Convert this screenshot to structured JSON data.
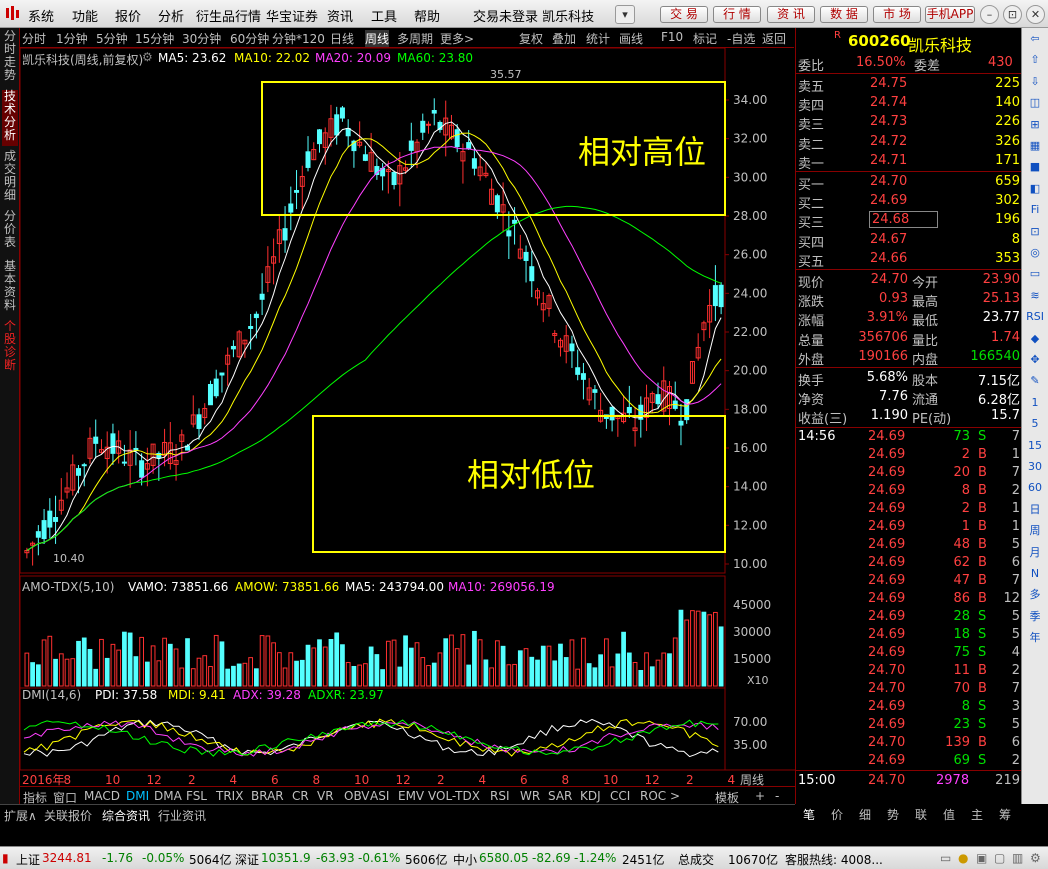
{
  "menubar": {
    "items": [
      "系统",
      "功能",
      "报价",
      "分析",
      "衍生品行情",
      "华宝证券",
      "资讯",
      "工具",
      "帮助"
    ],
    "title": "交易未登录  凯乐科技",
    "buttons": [
      "交 易",
      "行 情",
      "资 讯",
      "数 据",
      "市 场",
      "手机APP"
    ]
  },
  "toolbar": {
    "items": [
      "分时",
      "1分钟",
      "5分钟",
      "15分钟",
      "30分钟",
      "60分钟",
      "分钟*120",
      "日线",
      "周线",
      "多周期",
      "更多>"
    ],
    "active": "周线",
    "right": [
      "复权",
      "叠加",
      "统计",
      "画线",
      "F10",
      "标记",
      "-自选",
      "返回"
    ]
  },
  "left_tabs": [
    "分时走势",
    "技术分析",
    "成交明细",
    "分价表",
    "基本资料",
    "个股诊断"
  ],
  "chart_header": {
    "name": "凯乐科技(周线,前复权)",
    "ma5": "MA5: 23.62",
    "ma10": "MA10: 22.02",
    "ma20": "MA20: 20.09",
    "ma60": "MA60: 23.80"
  },
  "price_axis": [
    "34.00",
    "32.00",
    "30.00",
    "28.00",
    "26.00",
    "24.00",
    "22.00",
    "20.00",
    "18.00",
    "16.00",
    "14.00",
    "12.00",
    "10.00"
  ],
  "annotations": {
    "high_label": "相对高位",
    "low_label": "相对低位",
    "max_price": "35.57",
    "min_price": "10.40"
  },
  "volume_header": {
    "name": "AMO-TDX(5,10)",
    "vamo": "VAMO: 73851.66",
    "amow": "AMOW: 73851.66",
    "ma5": "MA5: 243794.00",
    "ma10": "MA10: 269056.19"
  },
  "volume_axis": [
    "45000",
    "30000",
    "15000"
  ],
  "volume_unit": "X10",
  "dmi_header": {
    "name": "DMI(14,6)",
    "pdi": "PDI: 37.58",
    "mdi": "MDI: 9.41",
    "adx": "ADX: 39.28",
    "adxr": "ADXR: 23.97"
  },
  "dmi_axis": [
    "70.00",
    "35.00"
  ],
  "date_axis": [
    "2016年",
    "8",
    "10",
    "12",
    "2",
    "4",
    "6",
    "8",
    "10",
    "12",
    "2",
    "4",
    "6",
    "8",
    "10",
    "12",
    "2",
    "4"
  ],
  "date_axis_right": "周线",
  "indicator_tabs": [
    "指标",
    "窗口",
    "MACD",
    "DMI",
    "DMA",
    "FSL",
    "TRIX",
    "BRAR",
    "CR",
    "VR",
    "OBV",
    "ASI",
    "EMV",
    "VOL-TDX",
    "RSI",
    "WR",
    "SAR",
    "KDJ",
    "CCI",
    "ROC",
    ">",
    "模板",
    "+",
    "-"
  ],
  "bottom_tabs": [
    "扩展∧",
    "关联报价",
    "综合资讯",
    "行业资讯"
  ],
  "quote": {
    "code": "600260",
    "name": "凯乐科技",
    "weibi_label": "委比",
    "weibi": "16.50%",
    "weicha_label": "委差",
    "weicha": "430",
    "asks": [
      {
        "label": "卖五",
        "price": "24.75",
        "vol": "225"
      },
      {
        "label": "卖四",
        "price": "24.74",
        "vol": "140"
      },
      {
        "label": "卖三",
        "price": "24.73",
        "vol": "226"
      },
      {
        "label": "卖二",
        "price": "24.72",
        "vol": "326"
      },
      {
        "label": "卖一",
        "price": "24.71",
        "vol": "171"
      }
    ],
    "bids": [
      {
        "label": "买一",
        "price": "24.70",
        "vol": "659"
      },
      {
        "label": "买二",
        "price": "24.69",
        "vol": "302"
      },
      {
        "label": "买三",
        "price": "24.68",
        "vol": "196"
      },
      {
        "label": "买四",
        "price": "24.67",
        "vol": "8"
      },
      {
        "label": "买五",
        "price": "24.66",
        "vol": "353"
      }
    ],
    "stats": [
      {
        "l1": "现价",
        "v1": "24.70",
        "l2": "今开",
        "v2": "23.90"
      },
      {
        "l1": "涨跌",
        "v1": "0.93",
        "l2": "最高",
        "v2": "25.13"
      },
      {
        "l1": "涨幅",
        "v1": "3.91%",
        "l2": "最低",
        "v2": "23.77"
      },
      {
        "l1": "总量",
        "v1": "356706",
        "l2": "量比",
        "v2": "1.74"
      },
      {
        "l1": "外盘",
        "v1": "190166",
        "l2": "内盘",
        "v2": "166540"
      }
    ],
    "fin": [
      {
        "l1": "换手",
        "v1": "5.68%",
        "l2": "股本",
        "v2": "7.15亿"
      },
      {
        "l1": "净资",
        "v1": "7.76",
        "l2": "流通",
        "v2": "6.28亿"
      },
      {
        "l1": "收益(三)",
        "v1": "1.190",
        "l2": "PE(动)",
        "v2": "15.7"
      }
    ],
    "ticks_first_time": "14:56",
    "ticks": [
      {
        "p": "24.69",
        "v": "73",
        "s": "S",
        "n": "7"
      },
      {
        "p": "24.69",
        "v": "2",
        "s": "B",
        "n": "1"
      },
      {
        "p": "24.69",
        "v": "20",
        "s": "B",
        "n": "7"
      },
      {
        "p": "24.69",
        "v": "8",
        "s": "B",
        "n": "2"
      },
      {
        "p": "24.69",
        "v": "2",
        "s": "B",
        "n": "1"
      },
      {
        "p": "24.69",
        "v": "1",
        "s": "B",
        "n": "1"
      },
      {
        "p": "24.69",
        "v": "48",
        "s": "B",
        "n": "5"
      },
      {
        "p": "24.69",
        "v": "62",
        "s": "B",
        "n": "6"
      },
      {
        "p": "24.69",
        "v": "47",
        "s": "B",
        "n": "7"
      },
      {
        "p": "24.69",
        "v": "86",
        "s": "B",
        "n": "12"
      },
      {
        "p": "24.69",
        "v": "28",
        "s": "S",
        "n": "5"
      },
      {
        "p": "24.69",
        "v": "18",
        "s": "S",
        "n": "5"
      },
      {
        "p": "24.69",
        "v": "75",
        "s": "S",
        "n": "4"
      },
      {
        "p": "24.70",
        "v": "11",
        "s": "B",
        "n": "2"
      },
      {
        "p": "24.70",
        "v": "70",
        "s": "B",
        "n": "7"
      },
      {
        "p": "24.69",
        "v": "8",
        "s": "S",
        "n": "3"
      },
      {
        "p": "24.69",
        "v": "23",
        "s": "S",
        "n": "5"
      },
      {
        "p": "24.70",
        "v": "139",
        "s": "B",
        "n": "6"
      },
      {
        "p": "24.69",
        "v": "69",
        "s": "S",
        "n": "2"
      }
    ],
    "last_time": "15:00",
    "last_price": "24.70",
    "last_vol": "2978",
    "last_n": "219"
  },
  "right_tabs": [
    "笔",
    "价",
    "细",
    "势",
    "联",
    "值",
    "主",
    "筹"
  ],
  "right_tools": [
    "⇦",
    "⇧",
    "⇩",
    "◫",
    "⊞",
    "▦",
    "■",
    "◧",
    "Fi",
    "⊡",
    "◎",
    "▭",
    "≋",
    "RSI",
    "◆",
    "✥",
    "✎",
    "1",
    "5",
    "15",
    "30",
    "60",
    "日",
    "周",
    "月",
    "N",
    "多",
    "季",
    "年"
  ],
  "status": {
    "sh_label": "上证",
    "sh_val": "3244.81",
    "sh_chg": "-1.76",
    "sh_pct": "-0.05%",
    "sh_amt": "5064亿",
    "sz_label": "深证",
    "sz_val": "10351.9",
    "sz_chg": "-63.93",
    "sz_pct": "-0.61%",
    "sz_amt": "5606亿",
    "zx_label": "中小",
    "zx_val": "6580.05",
    "zx_chg": "-82.69",
    "zx_pct": "-1.24%",
    "zx_amt": "2451亿",
    "total_label": "总成交",
    "total": "10670亿",
    "hotline": "客服热线: 4008..."
  },
  "colors": {
    "up": "#ff3030",
    "down": "#54ffff",
    "ma5": "#ffffff",
    "ma10": "#ffff00",
    "ma20": "#ff40ff",
    "ma60": "#00ff00",
    "box": "#ffff00"
  }
}
